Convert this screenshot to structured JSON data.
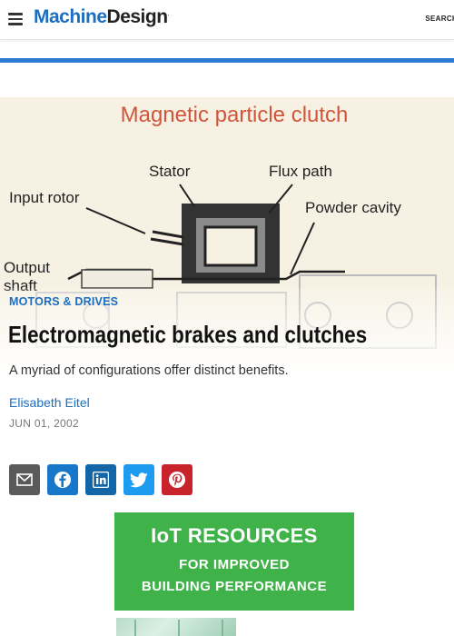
{
  "header": {
    "logo_part1": "Machine",
    "logo_part2": "Design",
    "logo_mark": ".",
    "search_label": "SEARCH"
  },
  "hero_image": {
    "title": "Magnetic particle clutch",
    "labels": {
      "stator": "Stator",
      "flux_path": "Flux path",
      "input_rotor": "Input rotor",
      "powder_cavity": "Powder cavity",
      "output_shaft": "Output",
      "output_shaft_2": "shaft"
    }
  },
  "article": {
    "category": "MOTORS & DRIVES",
    "title": "Electromagnetic brakes and clutches",
    "subtitle": "A myriad of configurations offer distinct benefits.",
    "author": "Elisabeth Eitel",
    "date": "JUN 01, 2002"
  },
  "share": [
    {
      "name": "email",
      "icon": "email-icon",
      "color": "#555555"
    },
    {
      "name": "facebook",
      "icon": "facebook-icon",
      "color": "#1877c9"
    },
    {
      "name": "linkedin",
      "icon": "linkedin-icon",
      "color": "#1266a8"
    },
    {
      "name": "twitter",
      "icon": "twitter-icon",
      "color": "#1d9bf0"
    },
    {
      "name": "pinterest",
      "icon": "pinterest-icon",
      "color": "#c8232c"
    }
  ],
  "ad": {
    "headline": "IoT RESOURCES",
    "line1": "FOR IMPROVED",
    "line2": "BUILDING PERFORMANCE"
  },
  "colors": {
    "brand_blue": "#1b6ec2",
    "accent_rule": "#2a7bd2",
    "ad_green": "#3fb24a"
  }
}
